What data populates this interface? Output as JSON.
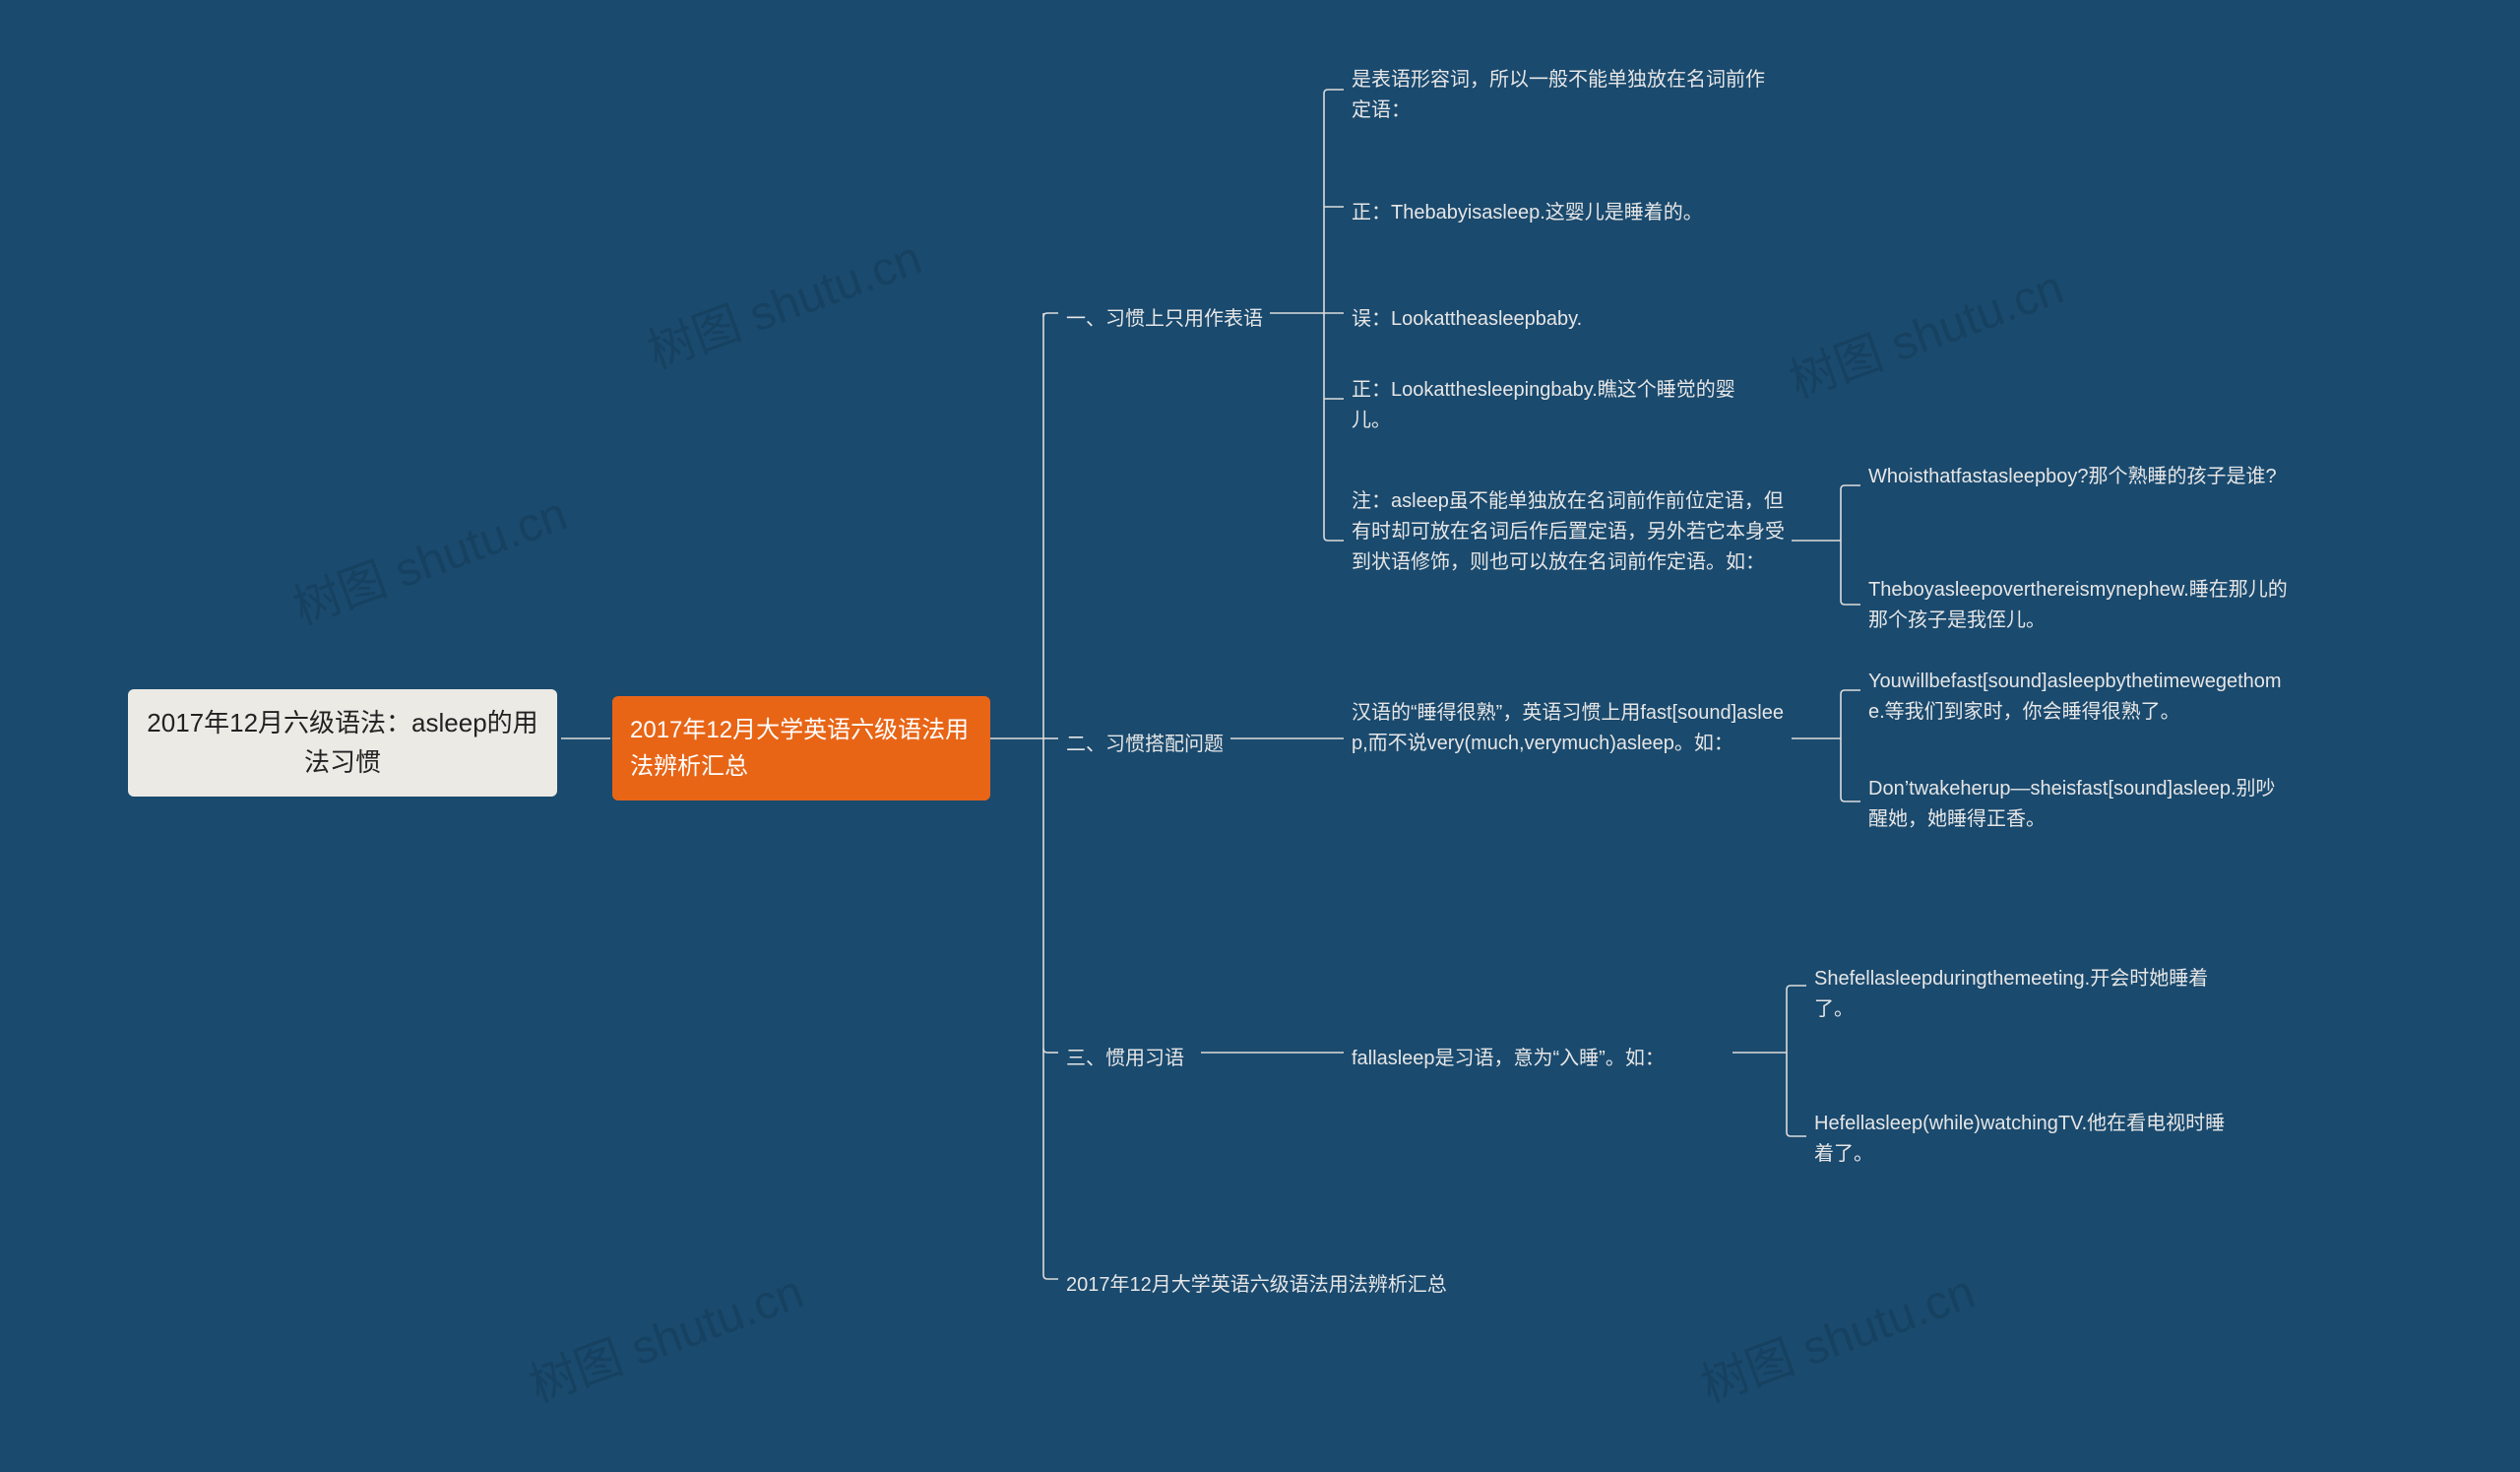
{
  "watermark": "树图 shutu.cn",
  "root": {
    "text": "2017年12月六级语法：asleep的用法习惯"
  },
  "sub_root": {
    "text": "2017年12月大学英语六级语法用法辨析汇总"
  },
  "sections": [
    {
      "label": "一、习惯上只用作表语",
      "children": [
        {
          "text": "是表语形容词，所以一般不能单独放在名词前作定语："
        },
        {
          "text": "正：Thebabyisasleep.这婴儿是睡着的。"
        },
        {
          "text": "误：Lookattheasleepbaby."
        },
        {
          "text": "正：Lookatthesleepingbaby.瞧这个睡觉的婴儿。"
        },
        {
          "text": "注：asleep虽不能单独放在名词前作前位定语，但有时却可放在名词后作后置定语，另外若它本身受到状语修饰，则也可以放在名词前作定语。如：",
          "children": [
            {
              "text": "Whoisthatfastasleepboy?那个熟睡的孩子是谁?"
            },
            {
              "text": "Theboyasleepoverthereismynephew.睡在那儿的那个孩子是我侄儿。"
            }
          ]
        }
      ]
    },
    {
      "label": "二、习惯搭配问题",
      "children": [
        {
          "text": "汉语的“睡得很熟”，英语习惯上用fast[sound]asleep,而不说very(much,verymuch)asleep。如：",
          "children": [
            {
              "text": "Youwillbefast[sound]asleepbythetimewegethome.等我们到家时，你会睡得很熟了。"
            },
            {
              "text": "Don’twakeherup—sheisfast[sound]asleep.别吵醒她，她睡得正香。"
            }
          ]
        }
      ]
    },
    {
      "label": "三、惯用习语",
      "children": [
        {
          "text": "fallasleep是习语，意为“入睡”。如：",
          "children": [
            {
              "text": "Shefellasleepduringthemeeting.开会时她睡着了。"
            },
            {
              "text": "Hefellasleep(while)watchingTV.他在看电视时睡着了。"
            }
          ]
        }
      ]
    },
    {
      "label": "2017年12月大学英语六级语法用法辨析汇总"
    }
  ]
}
